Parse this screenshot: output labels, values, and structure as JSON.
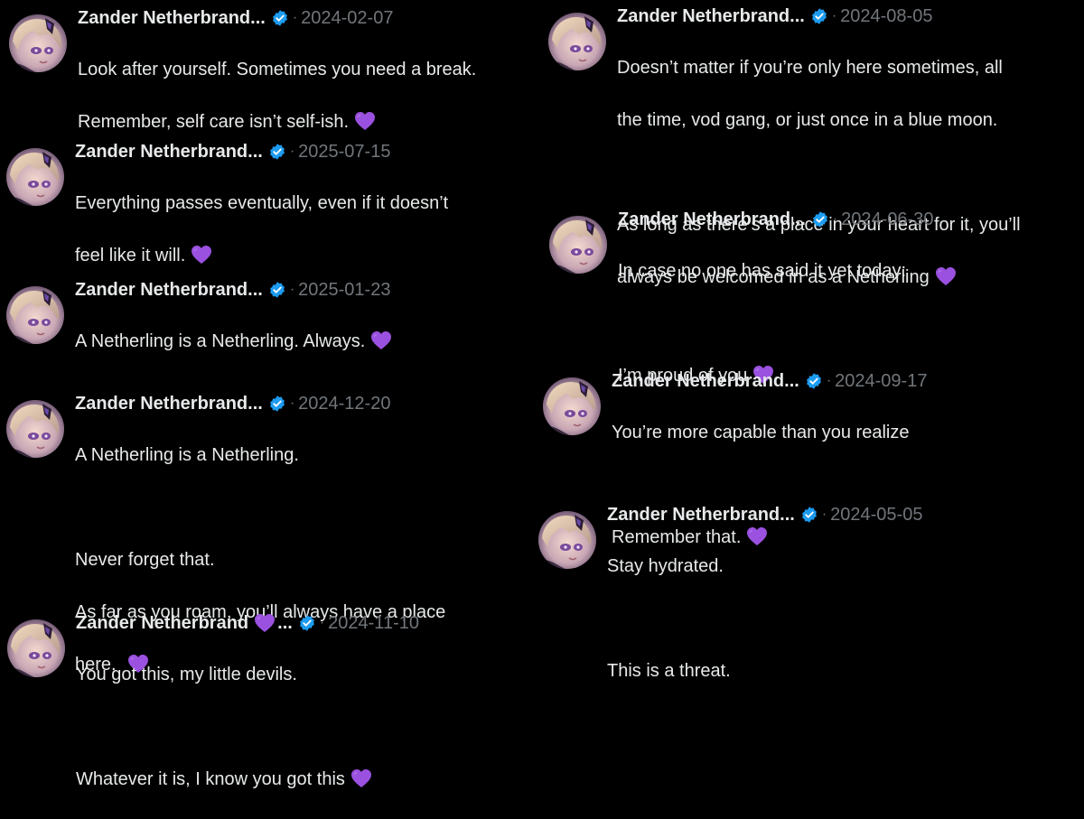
{
  "colors": {
    "background": "#000000",
    "text": "#e7e9ea",
    "muted": "#71767b",
    "verified": "#1d9bf0",
    "heart": "#9b51e0"
  },
  "icons": {
    "verified": "verified-badge-icon",
    "heart": "purple-heart-icon"
  },
  "tweets": [
    {
      "name": "Zander Netherbrand...",
      "separator": "·",
      "date": "2024-02-07",
      "lines": [
        "Look after yourself. Sometimes you need a break.",
        "Remember, self care isn’t self-ish."
      ]
    },
    {
      "name": "Zander Netherbrand...",
      "separator": "·",
      "date": "2025-07-15",
      "lines": [
        "Everything passes eventually, even if it doesn’t",
        "feel like it will."
      ]
    },
    {
      "name": "Zander Netherbrand...",
      "separator": "·",
      "date": "2025-01-23",
      "lines": [
        "A Netherling is a Netherling. Always."
      ]
    },
    {
      "name": "Zander Netherbrand...",
      "separator": "·",
      "date": "2024-12-20",
      "lines": [
        "A Netherling is a Netherling.",
        "",
        "Never forget that.",
        "As far as you roam, you’ll always have a place",
        "here."
      ]
    },
    {
      "name": "Zander Netherbrand",
      "name_suffix": "...",
      "separator": "·",
      "date": "2024-11-10",
      "lines": [
        "You got this, my little devils.",
        "",
        "Whatever it is, I know you got this"
      ]
    },
    {
      "name": "Zander Netherbrand...",
      "separator": "·",
      "date": "2024-08-05",
      "lines": [
        "Doesn’t matter if you’re only here sometimes, all",
        "the time, vod gang, or just once in a blue moon.",
        "",
        "As long as there’s a place in your heart for it, you’ll",
        "always be welcomed in as a Netherling"
      ]
    },
    {
      "name": "Zander Netherbrand...",
      "separator": "·",
      "date": "2024-06-30",
      "lines": [
        "In case no one has said it yet today:",
        "",
        "I’m proud of you"
      ]
    },
    {
      "name": "Zander Netherbrand...",
      "separator": "·",
      "date": "2024-09-17",
      "lines": [
        "You’re more capable than you realize",
        "",
        "Remember that."
      ]
    },
    {
      "name": "Zander Netherbrand...",
      "separator": "·",
      "date": "2024-05-05",
      "lines": [
        "Stay hydrated.",
        "",
        "This is a threat."
      ]
    }
  ]
}
